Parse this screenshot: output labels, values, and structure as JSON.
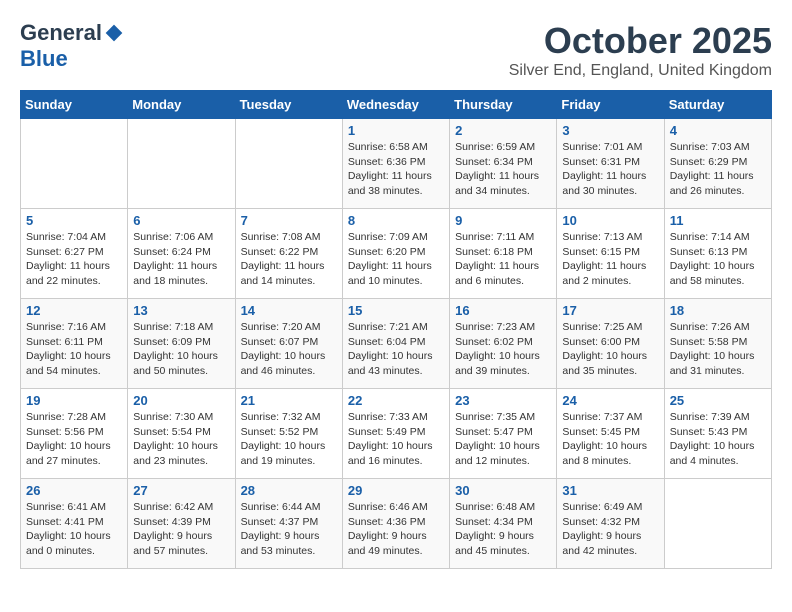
{
  "logo": {
    "general": "General",
    "blue": "Blue"
  },
  "title": "October 2025",
  "location": "Silver End, England, United Kingdom",
  "weekdays": [
    "Sunday",
    "Monday",
    "Tuesday",
    "Wednesday",
    "Thursday",
    "Friday",
    "Saturday"
  ],
  "weeks": [
    [
      {
        "day": "",
        "info": ""
      },
      {
        "day": "",
        "info": ""
      },
      {
        "day": "",
        "info": ""
      },
      {
        "day": "1",
        "info": "Sunrise: 6:58 AM\nSunset: 6:36 PM\nDaylight: 11 hours\nand 38 minutes."
      },
      {
        "day": "2",
        "info": "Sunrise: 6:59 AM\nSunset: 6:34 PM\nDaylight: 11 hours\nand 34 minutes."
      },
      {
        "day": "3",
        "info": "Sunrise: 7:01 AM\nSunset: 6:31 PM\nDaylight: 11 hours\nand 30 minutes."
      },
      {
        "day": "4",
        "info": "Sunrise: 7:03 AM\nSunset: 6:29 PM\nDaylight: 11 hours\nand 26 minutes."
      }
    ],
    [
      {
        "day": "5",
        "info": "Sunrise: 7:04 AM\nSunset: 6:27 PM\nDaylight: 11 hours\nand 22 minutes."
      },
      {
        "day": "6",
        "info": "Sunrise: 7:06 AM\nSunset: 6:24 PM\nDaylight: 11 hours\nand 18 minutes."
      },
      {
        "day": "7",
        "info": "Sunrise: 7:08 AM\nSunset: 6:22 PM\nDaylight: 11 hours\nand 14 minutes."
      },
      {
        "day": "8",
        "info": "Sunrise: 7:09 AM\nSunset: 6:20 PM\nDaylight: 11 hours\nand 10 minutes."
      },
      {
        "day": "9",
        "info": "Sunrise: 7:11 AM\nSunset: 6:18 PM\nDaylight: 11 hours\nand 6 minutes."
      },
      {
        "day": "10",
        "info": "Sunrise: 7:13 AM\nSunset: 6:15 PM\nDaylight: 11 hours\nand 2 minutes."
      },
      {
        "day": "11",
        "info": "Sunrise: 7:14 AM\nSunset: 6:13 PM\nDaylight: 10 hours\nand 58 minutes."
      }
    ],
    [
      {
        "day": "12",
        "info": "Sunrise: 7:16 AM\nSunset: 6:11 PM\nDaylight: 10 hours\nand 54 minutes."
      },
      {
        "day": "13",
        "info": "Sunrise: 7:18 AM\nSunset: 6:09 PM\nDaylight: 10 hours\nand 50 minutes."
      },
      {
        "day": "14",
        "info": "Sunrise: 7:20 AM\nSunset: 6:07 PM\nDaylight: 10 hours\nand 46 minutes."
      },
      {
        "day": "15",
        "info": "Sunrise: 7:21 AM\nSunset: 6:04 PM\nDaylight: 10 hours\nand 43 minutes."
      },
      {
        "day": "16",
        "info": "Sunrise: 7:23 AM\nSunset: 6:02 PM\nDaylight: 10 hours\nand 39 minutes."
      },
      {
        "day": "17",
        "info": "Sunrise: 7:25 AM\nSunset: 6:00 PM\nDaylight: 10 hours\nand 35 minutes."
      },
      {
        "day": "18",
        "info": "Sunrise: 7:26 AM\nSunset: 5:58 PM\nDaylight: 10 hours\nand 31 minutes."
      }
    ],
    [
      {
        "day": "19",
        "info": "Sunrise: 7:28 AM\nSunset: 5:56 PM\nDaylight: 10 hours\nand 27 minutes."
      },
      {
        "day": "20",
        "info": "Sunrise: 7:30 AM\nSunset: 5:54 PM\nDaylight: 10 hours\nand 23 minutes."
      },
      {
        "day": "21",
        "info": "Sunrise: 7:32 AM\nSunset: 5:52 PM\nDaylight: 10 hours\nand 19 minutes."
      },
      {
        "day": "22",
        "info": "Sunrise: 7:33 AM\nSunset: 5:49 PM\nDaylight: 10 hours\nand 16 minutes."
      },
      {
        "day": "23",
        "info": "Sunrise: 7:35 AM\nSunset: 5:47 PM\nDaylight: 10 hours\nand 12 minutes."
      },
      {
        "day": "24",
        "info": "Sunrise: 7:37 AM\nSunset: 5:45 PM\nDaylight: 10 hours\nand 8 minutes."
      },
      {
        "day": "25",
        "info": "Sunrise: 7:39 AM\nSunset: 5:43 PM\nDaylight: 10 hours\nand 4 minutes."
      }
    ],
    [
      {
        "day": "26",
        "info": "Sunrise: 6:41 AM\nSunset: 4:41 PM\nDaylight: 10 hours\nand 0 minutes."
      },
      {
        "day": "27",
        "info": "Sunrise: 6:42 AM\nSunset: 4:39 PM\nDaylight: 9 hours\nand 57 minutes."
      },
      {
        "day": "28",
        "info": "Sunrise: 6:44 AM\nSunset: 4:37 PM\nDaylight: 9 hours\nand 53 minutes."
      },
      {
        "day": "29",
        "info": "Sunrise: 6:46 AM\nSunset: 4:36 PM\nDaylight: 9 hours\nand 49 minutes."
      },
      {
        "day": "30",
        "info": "Sunrise: 6:48 AM\nSunset: 4:34 PM\nDaylight: 9 hours\nand 45 minutes."
      },
      {
        "day": "31",
        "info": "Sunrise: 6:49 AM\nSunset: 4:32 PM\nDaylight: 9 hours\nand 42 minutes."
      },
      {
        "day": "",
        "info": ""
      }
    ]
  ]
}
